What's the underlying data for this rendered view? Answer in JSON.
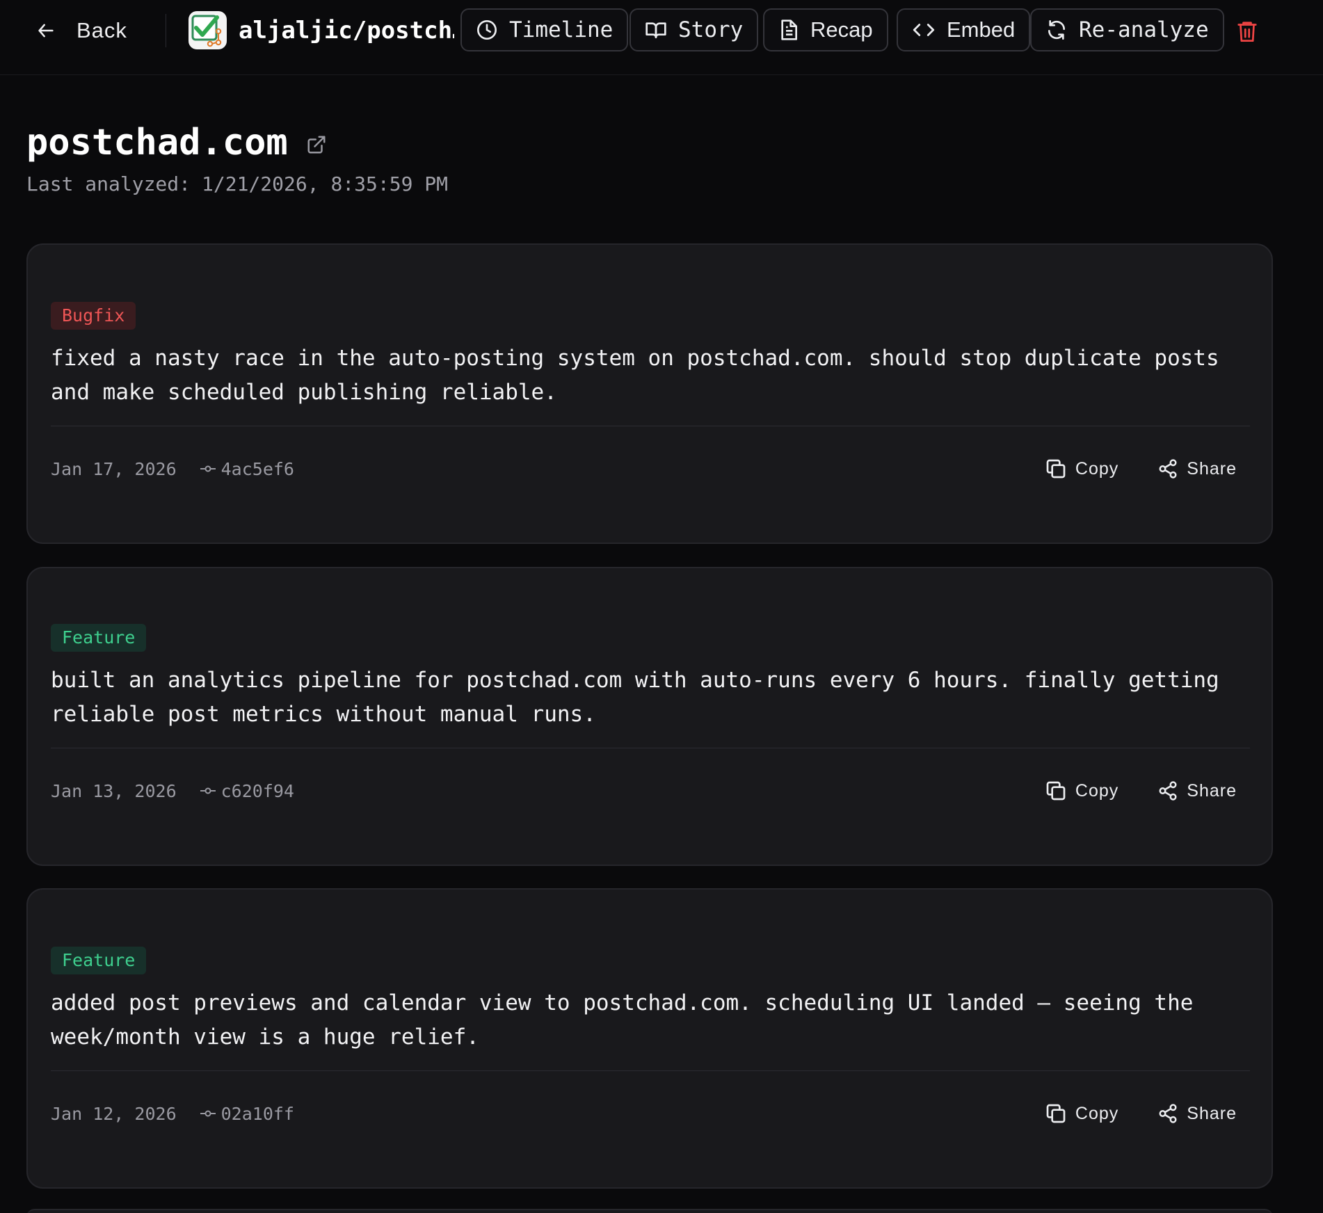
{
  "header": {
    "back_label": "Back",
    "repo_name": "aljaljic/postch…",
    "nav": [
      {
        "label": "Timeline",
        "icon": "clock-icon"
      },
      {
        "label": "Story",
        "icon": "book-icon"
      },
      {
        "label": "Recap",
        "icon": "document-icon"
      },
      {
        "label": "Embed",
        "icon": "code-icon"
      },
      {
        "label": "Re-analyze",
        "icon": "refresh-icon"
      }
    ],
    "delete_icon": "trash-icon"
  },
  "page": {
    "title": "postchad.com",
    "last_analyzed_label": "Last analyzed:",
    "last_analyzed_value": "1/21/2026, 8:35:59 PM"
  },
  "entries": [
    {
      "tag": "Bugfix",
      "text": "fixed a nasty race in the auto-posting system on postchad.com. should stop duplicate posts and make scheduled publishing reliable.",
      "date": "Jan 17, 2026",
      "commit": "4ac5ef6",
      "copy_label": "Copy",
      "share_label": "Share"
    },
    {
      "tag": "Feature",
      "text": "built an analytics pipeline for postchad.com with auto-runs every 6 hours. finally getting reliable post metrics without manual runs.",
      "date": "Jan 13, 2026",
      "commit": "c620f94",
      "copy_label": "Copy",
      "share_label": "Share"
    },
    {
      "tag": "Feature",
      "text": "added post previews and calendar view to postchad.com. scheduling UI landed — seeing the week/month view is a huge relief.",
      "date": "Jan 12, 2026",
      "commit": "02a10ff",
      "copy_label": "Copy",
      "share_label": "Share"
    }
  ],
  "colors": {
    "background": "#0a0a0c",
    "card": "#19191c",
    "bugfix": "#ef5656",
    "feature": "#3ecf8e",
    "danger": "#ef4444"
  }
}
